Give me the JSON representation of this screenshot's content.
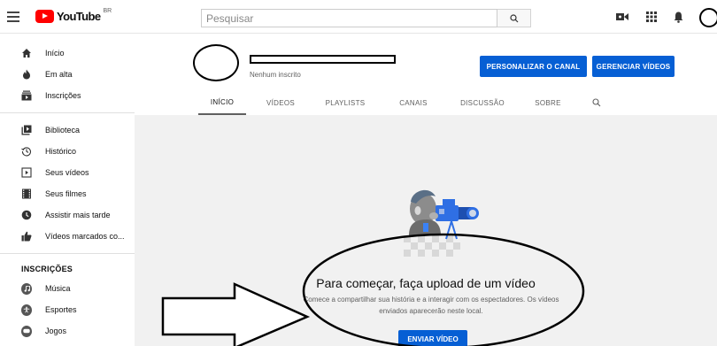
{
  "header": {
    "logo_text": "YouTube",
    "logo_region": "BR",
    "search_placeholder": "Pesquisar",
    "icons": [
      "menu-icon",
      "search-icon",
      "create-video-icon",
      "apps-icon",
      "notifications-icon"
    ]
  },
  "sidebar": {
    "main": [
      {
        "label": "Início",
        "icon": "home-icon"
      },
      {
        "label": "Em alta",
        "icon": "trending-icon"
      },
      {
        "label": "Inscrições",
        "icon": "subscriptions-icon"
      }
    ],
    "library": [
      {
        "label": "Biblioteca",
        "icon": "library-icon"
      },
      {
        "label": "Histórico",
        "icon": "history-icon"
      },
      {
        "label": "Seus vídeos",
        "icon": "your-videos-icon"
      },
      {
        "label": "Seus filmes",
        "icon": "movies-icon"
      },
      {
        "label": "Assistir mais tarde",
        "icon": "watch-later-icon"
      },
      {
        "label": "Vídeos marcados co...",
        "icon": "liked-icon"
      }
    ],
    "subscriptions_header": "INSCRIÇÕES",
    "subscriptions": [
      {
        "label": "Música",
        "icon": "music-icon"
      },
      {
        "label": "Esportes",
        "icon": "sports-icon"
      },
      {
        "label": "Jogos",
        "icon": "gaming-icon"
      }
    ]
  },
  "channel": {
    "subscribers": "Nenhum inscrito",
    "customize_button": "PERSONALIZAR O CANAL",
    "manage_button": "GERENCIAR VÍDEOS",
    "tabs": [
      "INÍCIO",
      "VÍDEOS",
      "PLAYLISTS",
      "CANAIS",
      "DISCUSSÃO",
      "SOBRE"
    ],
    "active_tab": "INÍCIO"
  },
  "empty_state": {
    "title": "Para começar, faça upload de um vídeo",
    "description": "Comece a compartilhar sua história e a interagir com os espectadores. Os vídeos enviados aparecerão neste local.",
    "upload_button": "ENVIAR VÍDEO"
  },
  "colors": {
    "brand_red": "#ff0000",
    "button_blue": "#065fd4",
    "content_bg": "#f1f1f1"
  }
}
